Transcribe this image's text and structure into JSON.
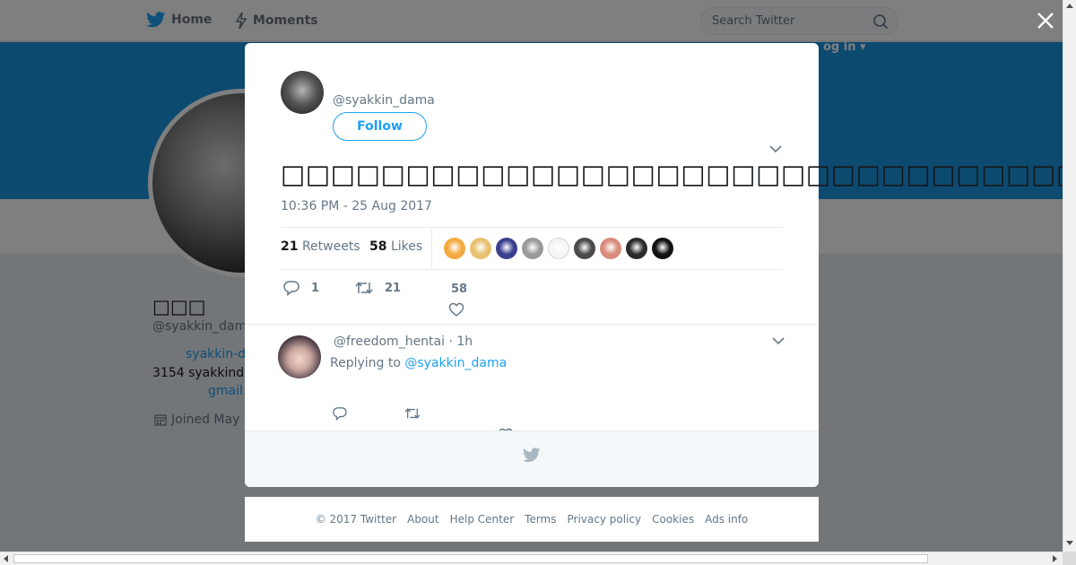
{
  "nav": {
    "home_label": "Home",
    "moments_label": "Moments",
    "search_placeholder": "Search Twitter",
    "login_label": "og in ▾"
  },
  "profile": {
    "name": "□□□",
    "handle": "@syakkin_dam",
    "bio_link1": "syakkin-d",
    "bio_text": "3154 syakkind",
    "bio_link2": "gmail.",
    "joined": "Joined May"
  },
  "tweet": {
    "handle": "@syakkin_dama",
    "follow_label": "Follow",
    "text": "□□□□□□□□□□□□□□□□□□□□□□□□□□□□□□□□□□□□□□□□□□□□□□□□□",
    "timestamp": "10:36 PM - 25 Aug 2017",
    "retweets_count": "21",
    "retweets_label": "Retweets",
    "likes_count": "58",
    "likes_label": "Likes",
    "likers": [
      "#f4a940",
      "#e8c070",
      "#3a3f8f",
      "#9a9a9a",
      "#f5f5f5",
      "#4a4a4a",
      "#d98a7a",
      "#2b2b2b",
      "#111111"
    ],
    "reply_count": "1",
    "retweet_count_action": "21",
    "like_count_action": "58"
  },
  "reply": {
    "header": "@freedom_hentai · 1h",
    "replying_prefix": "Replying to",
    "replying_to": "@syakkin_dama"
  },
  "footer": {
    "links": [
      "© 2017 Twitter",
      "About",
      "Help Center",
      "Terms",
      "Privacy policy",
      "Cookies",
      "Ads info"
    ]
  },
  "colors": {
    "accent": "#1da1f2",
    "banner": "#1b95e0",
    "muted_text": "#657786"
  }
}
